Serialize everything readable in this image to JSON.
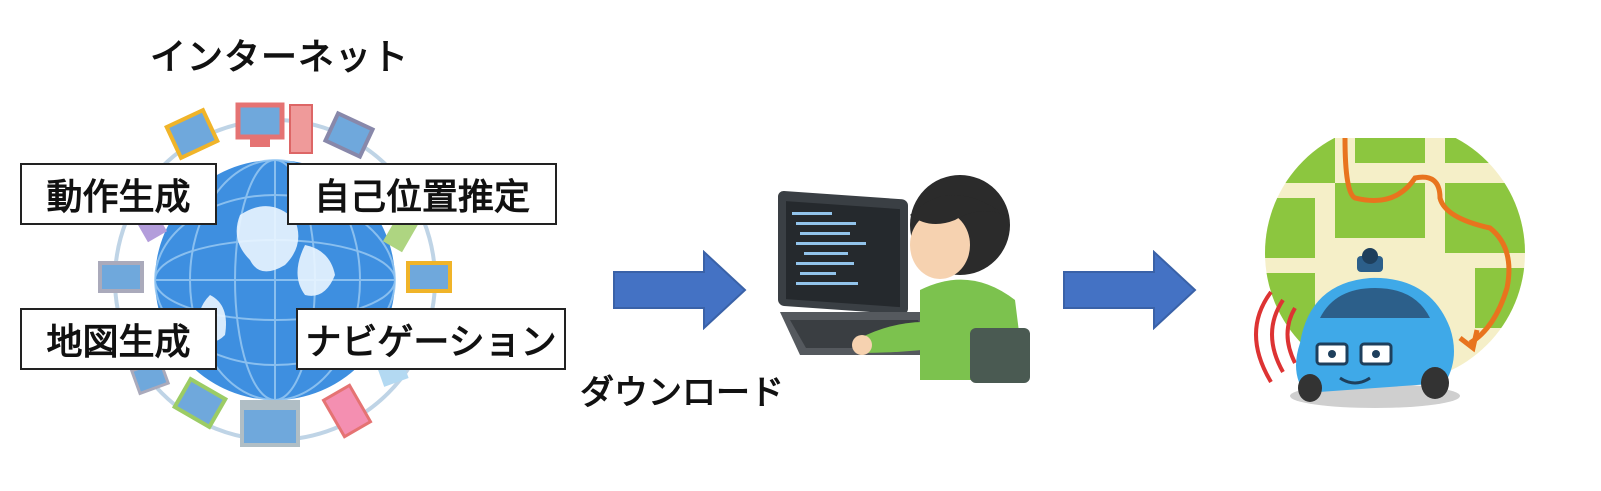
{
  "internet_title": "インターネット",
  "features": {
    "motion_generation": "動作生成",
    "self_localization": "自己位置推定",
    "map_generation": "地図生成",
    "navigation": "ナビゲーション"
  },
  "download_label": "ダウンロード",
  "colors": {
    "arrow": "#4472C4",
    "globe": "#3E8FE0",
    "car": "#3FA9E8",
    "map_green": "#8CC63F",
    "route": "#E8741E",
    "shirt": "#7CC24E"
  },
  "icons": [
    "globe-network-icon",
    "programmer-laptop-icon",
    "autonomous-car-map-icon"
  ]
}
